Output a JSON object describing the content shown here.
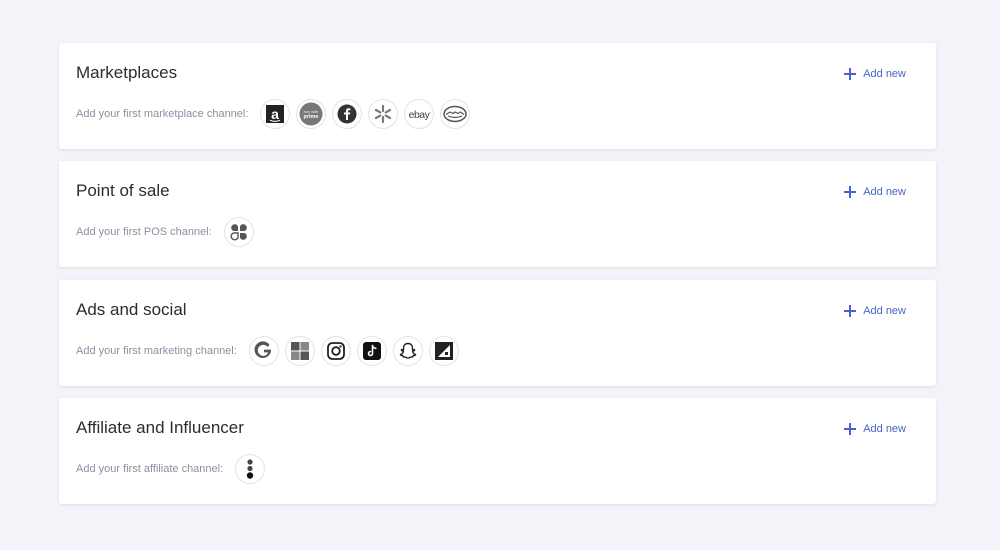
{
  "add_new_label": "Add new",
  "sections": [
    {
      "title": "Marketplaces",
      "hint": "Add your first marketplace channel:",
      "icons": [
        "amazon-icon",
        "buy-with-prime-icon",
        "facebook-icon",
        "walmart-icon",
        "ebay-icon",
        "mercado-libre-icon"
      ],
      "prime_text": "buy with prime",
      "ebay_text": "ebay"
    },
    {
      "title": "Point of sale",
      "hint": "Add your first POS channel:",
      "icons": [
        "square-pos-icon"
      ]
    },
    {
      "title": "Ads and social",
      "hint": "Add your first marketing channel:",
      "icons": [
        "google-icon",
        "microsoft-icon",
        "instagram-icon",
        "tiktok-icon",
        "snapchat-icon",
        "pinterest-icon"
      ]
    },
    {
      "title": "Affiliate and Influencer",
      "hint": "Add your first affiliate channel:",
      "icons": [
        "affiliate-icon"
      ]
    }
  ],
  "colors": {
    "accent": "#4a63c9",
    "background": "#f3f4f9",
    "card": "#ffffff",
    "hint_text": "#8a90a0",
    "title_text": "#2a2d33"
  }
}
